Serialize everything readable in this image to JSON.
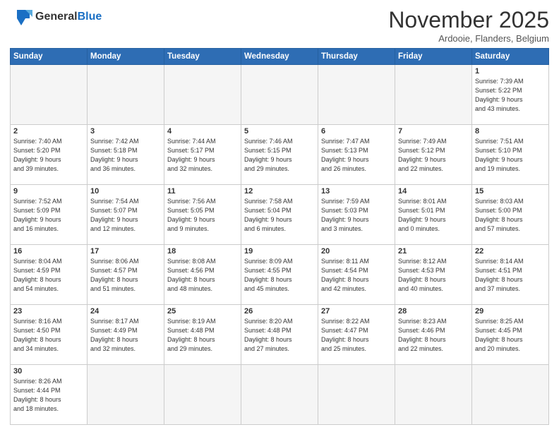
{
  "header": {
    "logo_general": "General",
    "logo_blue": "Blue",
    "month_title": "November 2025",
    "location": "Ardooie, Flanders, Belgium"
  },
  "weekdays": [
    "Sunday",
    "Monday",
    "Tuesday",
    "Wednesday",
    "Thursday",
    "Friday",
    "Saturday"
  ],
  "weeks": [
    [
      {
        "day": "",
        "info": "",
        "empty": true
      },
      {
        "day": "",
        "info": "",
        "empty": true
      },
      {
        "day": "",
        "info": "",
        "empty": true
      },
      {
        "day": "",
        "info": "",
        "empty": true
      },
      {
        "day": "",
        "info": "",
        "empty": true
      },
      {
        "day": "",
        "info": "",
        "empty": true
      },
      {
        "day": "1",
        "info": "Sunrise: 7:39 AM\nSunset: 5:22 PM\nDaylight: 9 hours\nand 43 minutes."
      }
    ],
    [
      {
        "day": "2",
        "info": "Sunrise: 7:40 AM\nSunset: 5:20 PM\nDaylight: 9 hours\nand 39 minutes."
      },
      {
        "day": "3",
        "info": "Sunrise: 7:42 AM\nSunset: 5:18 PM\nDaylight: 9 hours\nand 36 minutes."
      },
      {
        "day": "4",
        "info": "Sunrise: 7:44 AM\nSunset: 5:17 PM\nDaylight: 9 hours\nand 32 minutes."
      },
      {
        "day": "5",
        "info": "Sunrise: 7:46 AM\nSunset: 5:15 PM\nDaylight: 9 hours\nand 29 minutes."
      },
      {
        "day": "6",
        "info": "Sunrise: 7:47 AM\nSunset: 5:13 PM\nDaylight: 9 hours\nand 26 minutes."
      },
      {
        "day": "7",
        "info": "Sunrise: 7:49 AM\nSunset: 5:12 PM\nDaylight: 9 hours\nand 22 minutes."
      },
      {
        "day": "8",
        "info": "Sunrise: 7:51 AM\nSunset: 5:10 PM\nDaylight: 9 hours\nand 19 minutes."
      }
    ],
    [
      {
        "day": "9",
        "info": "Sunrise: 7:52 AM\nSunset: 5:09 PM\nDaylight: 9 hours\nand 16 minutes."
      },
      {
        "day": "10",
        "info": "Sunrise: 7:54 AM\nSunset: 5:07 PM\nDaylight: 9 hours\nand 12 minutes."
      },
      {
        "day": "11",
        "info": "Sunrise: 7:56 AM\nSunset: 5:05 PM\nDaylight: 9 hours\nand 9 minutes."
      },
      {
        "day": "12",
        "info": "Sunrise: 7:58 AM\nSunset: 5:04 PM\nDaylight: 9 hours\nand 6 minutes."
      },
      {
        "day": "13",
        "info": "Sunrise: 7:59 AM\nSunset: 5:03 PM\nDaylight: 9 hours\nand 3 minutes."
      },
      {
        "day": "14",
        "info": "Sunrise: 8:01 AM\nSunset: 5:01 PM\nDaylight: 9 hours\nand 0 minutes."
      },
      {
        "day": "15",
        "info": "Sunrise: 8:03 AM\nSunset: 5:00 PM\nDaylight: 8 hours\nand 57 minutes."
      }
    ],
    [
      {
        "day": "16",
        "info": "Sunrise: 8:04 AM\nSunset: 4:59 PM\nDaylight: 8 hours\nand 54 minutes."
      },
      {
        "day": "17",
        "info": "Sunrise: 8:06 AM\nSunset: 4:57 PM\nDaylight: 8 hours\nand 51 minutes."
      },
      {
        "day": "18",
        "info": "Sunrise: 8:08 AM\nSunset: 4:56 PM\nDaylight: 8 hours\nand 48 minutes."
      },
      {
        "day": "19",
        "info": "Sunrise: 8:09 AM\nSunset: 4:55 PM\nDaylight: 8 hours\nand 45 minutes."
      },
      {
        "day": "20",
        "info": "Sunrise: 8:11 AM\nSunset: 4:54 PM\nDaylight: 8 hours\nand 42 minutes."
      },
      {
        "day": "21",
        "info": "Sunrise: 8:12 AM\nSunset: 4:53 PM\nDaylight: 8 hours\nand 40 minutes."
      },
      {
        "day": "22",
        "info": "Sunrise: 8:14 AM\nSunset: 4:51 PM\nDaylight: 8 hours\nand 37 minutes."
      }
    ],
    [
      {
        "day": "23",
        "info": "Sunrise: 8:16 AM\nSunset: 4:50 PM\nDaylight: 8 hours\nand 34 minutes."
      },
      {
        "day": "24",
        "info": "Sunrise: 8:17 AM\nSunset: 4:49 PM\nDaylight: 8 hours\nand 32 minutes."
      },
      {
        "day": "25",
        "info": "Sunrise: 8:19 AM\nSunset: 4:48 PM\nDaylight: 8 hours\nand 29 minutes."
      },
      {
        "day": "26",
        "info": "Sunrise: 8:20 AM\nSunset: 4:48 PM\nDaylight: 8 hours\nand 27 minutes."
      },
      {
        "day": "27",
        "info": "Sunrise: 8:22 AM\nSunset: 4:47 PM\nDaylight: 8 hours\nand 25 minutes."
      },
      {
        "day": "28",
        "info": "Sunrise: 8:23 AM\nSunset: 4:46 PM\nDaylight: 8 hours\nand 22 minutes."
      },
      {
        "day": "29",
        "info": "Sunrise: 8:25 AM\nSunset: 4:45 PM\nDaylight: 8 hours\nand 20 minutes."
      }
    ],
    [
      {
        "day": "30",
        "info": "Sunrise: 8:26 AM\nSunset: 4:44 PM\nDaylight: 8 hours\nand 18 minutes.",
        "last": true
      },
      {
        "day": "",
        "info": "",
        "empty": true,
        "last": true
      },
      {
        "day": "",
        "info": "",
        "empty": true,
        "last": true
      },
      {
        "day": "",
        "info": "",
        "empty": true,
        "last": true
      },
      {
        "day": "",
        "info": "",
        "empty": true,
        "last": true
      },
      {
        "day": "",
        "info": "",
        "empty": true,
        "last": true
      },
      {
        "day": "",
        "info": "",
        "empty": true,
        "last": true
      }
    ]
  ]
}
